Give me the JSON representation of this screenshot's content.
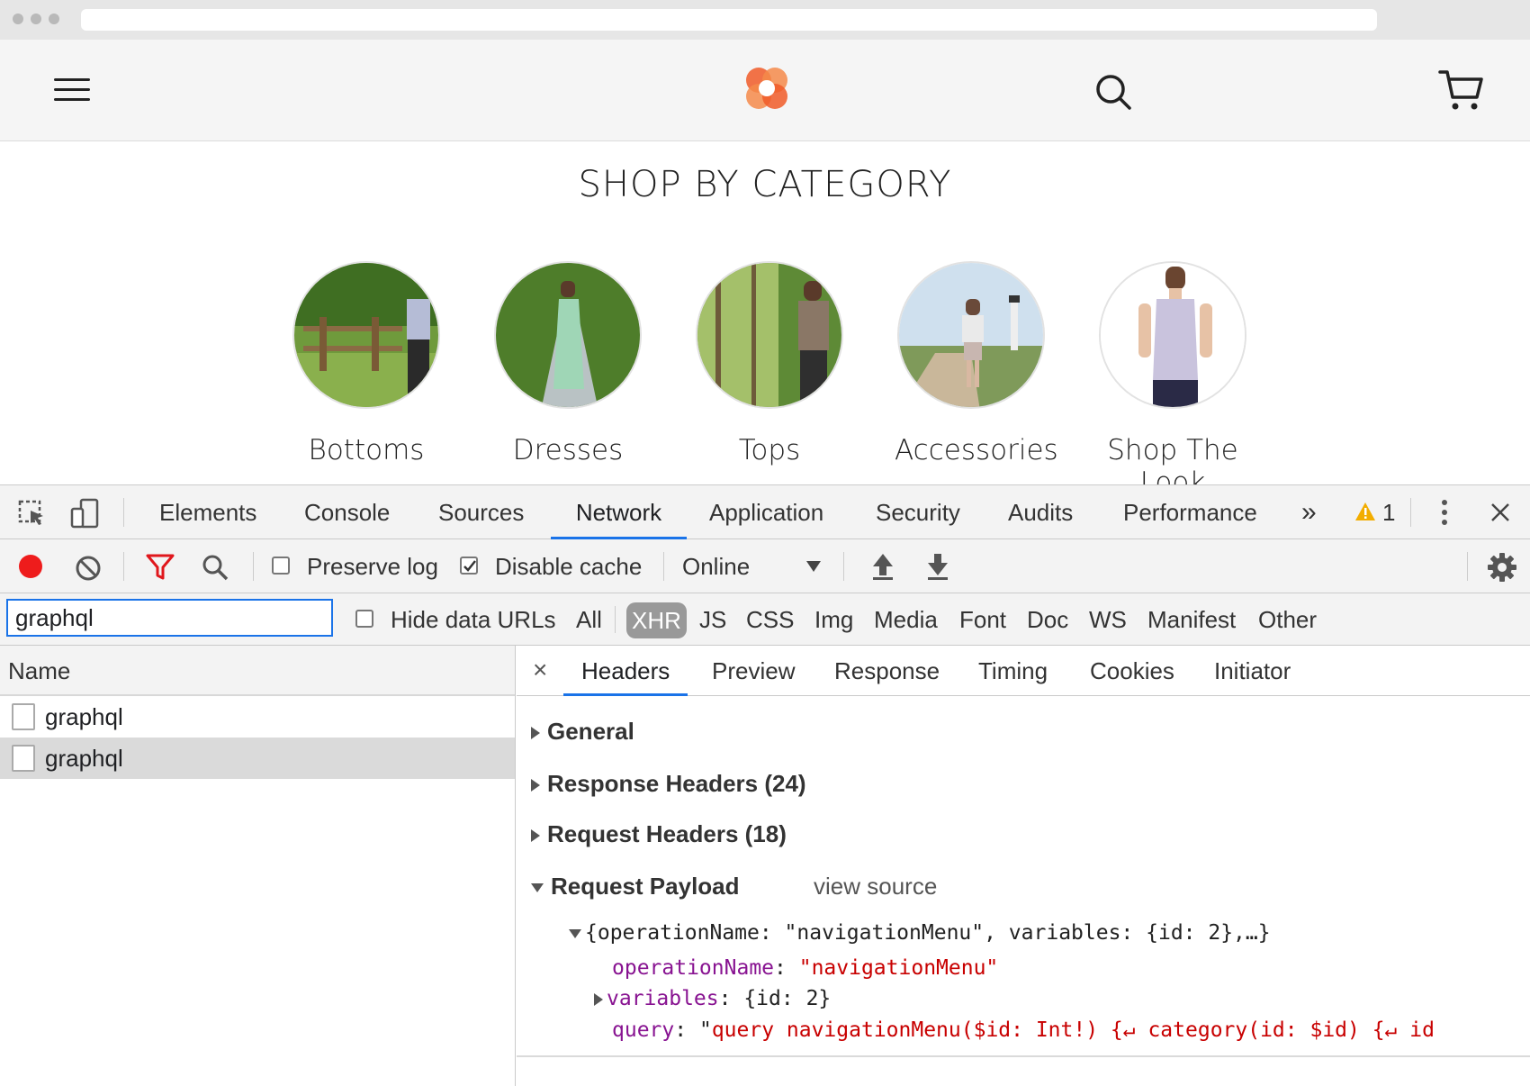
{
  "site": {
    "section_title": "SHOP BY CATEGORY",
    "categories": [
      {
        "label": "Bottoms"
      },
      {
        "label": "Dresses"
      },
      {
        "label": "Tops"
      },
      {
        "label": "Accessories"
      },
      {
        "label": "Shop The Look"
      }
    ],
    "icons": {
      "menu": "hamburger-menu-icon",
      "logo": "brand-logo-icon",
      "search": "search-icon",
      "cart": "cart-icon"
    },
    "brand_color": "#f05a28"
  },
  "devtools": {
    "tabs": [
      "Elements",
      "Console",
      "Sources",
      "Network",
      "Application",
      "Security",
      "Audits",
      "Performance"
    ],
    "active_tab": "Network",
    "more_tabs": "»",
    "warning_count": "1",
    "toolbar": {
      "preserve_log": "Preserve log",
      "preserve_log_checked": false,
      "disable_cache": "Disable cache",
      "disable_cache_checked": true,
      "throttle": "Online"
    },
    "filter": {
      "value": "graphql",
      "hide_data_urls": "Hide data URLs",
      "types": [
        "All",
        "XHR",
        "JS",
        "CSS",
        "Img",
        "Media",
        "Font",
        "Doc",
        "WS",
        "Manifest",
        "Other"
      ],
      "active_type": "XHR"
    },
    "name_column": {
      "header": "Name",
      "rows": [
        "graphql",
        "graphql"
      ],
      "selected_index": 1
    },
    "detail": {
      "tabs": [
        "Headers",
        "Preview",
        "Response",
        "Timing",
        "Cookies",
        "Initiator"
      ],
      "active_tab": "Headers",
      "close": "×",
      "sections": {
        "general": "General",
        "response_headers": "Response Headers (24)",
        "request_headers": "Request Headers (18)",
        "request_payload": "Request Payload",
        "view_source": "view source"
      },
      "payload": {
        "summary": "{operationName: \"navigationMenu\", variables: {id: 2},…}",
        "operation_key": "operationName",
        "operation_value": "\"navigationMenu\"",
        "variables_key": "variables",
        "variables_value": "{id: 2}",
        "query_key": "query",
        "query_open": "\"",
        "query_value": "query navigationMenu($id: Int!) {↵  category(id: $id) {↵    id"
      }
    }
  }
}
